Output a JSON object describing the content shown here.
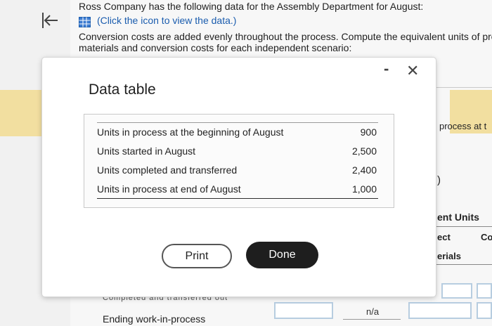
{
  "page": {
    "intro_line_1": "Ross Company has the following data for the Assembly Department for August:",
    "view_data_link": "(Click the icon to view the data.)",
    "intro_line_3": "Conversion costs are added evenly throughout the process. Compute the equivalent units of pro",
    "intro_line_4": "materials and conversion costs for each independent scenario:",
    "right_process_text": "process at t",
    "right_paren": ")",
    "right_units_header": "ent Units",
    "right_direct": "ect",
    "right_materials": "erials",
    "right_co": "Co",
    "ending_wip_label": "Ending work-in-process",
    "na_value": "n/a",
    "cut_off_text": "Completed and transferred out"
  },
  "icons": {
    "back": "back-arrow-icon",
    "table": "table-grid-icon"
  },
  "modal": {
    "title": "Data table",
    "minimize_label": "-",
    "close_label": "✕",
    "rows": [
      {
        "label": "Units in process at the beginning of August",
        "value": "900"
      },
      {
        "label": "Units started in August",
        "value": "2,500"
      },
      {
        "label": "Units completed and transferred",
        "value": "2,400"
      },
      {
        "label": "Units in process at end of August",
        "value": "1,000"
      }
    ],
    "print_label": "Print",
    "done_label": "Done"
  },
  "colors": {
    "link": "#1a5cae",
    "yellow_band": "#f2dfa0",
    "done_button": "#1e1e1e"
  }
}
